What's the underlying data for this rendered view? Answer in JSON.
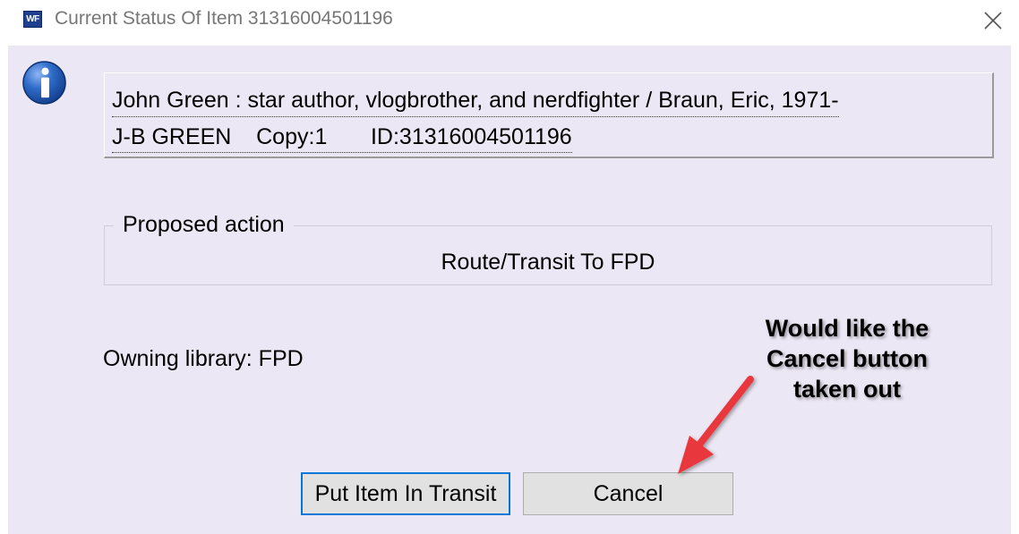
{
  "window": {
    "app_icon_text": "WF",
    "title": "Current Status Of Item 31316004501196"
  },
  "item": {
    "title_line": "John Green : star author, vlogbrother, and nerdfighter / Braun, Eric, 1971-",
    "detail_line": "J-B GREEN    Copy:1       ID:31316004501196"
  },
  "proposed_action": {
    "label": "Proposed action",
    "value": "Route/Transit To FPD"
  },
  "owning_library": "Owning library: FPD",
  "buttons": {
    "transit": "Put Item In Transit",
    "cancel": "Cancel"
  },
  "annotation": {
    "line1": "Would like the",
    "line2": "Cancel button",
    "line3": "taken out",
    "arrow_color": "#e8383d"
  },
  "colors": {
    "dialog_bg": "#ece7f4",
    "focus_border": "#0078d7"
  }
}
